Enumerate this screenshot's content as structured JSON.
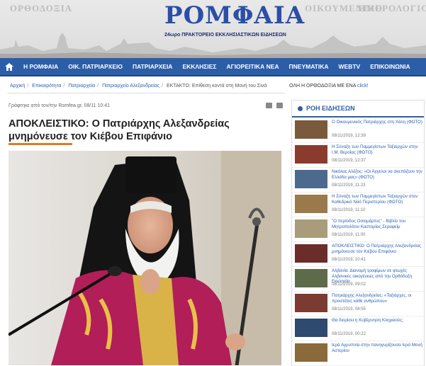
{
  "header": {
    "logo": "ΡΟΜΦΑΙΑ",
    "tagline": "24ωρο ΠΡΑΚΤΟΡΕΙΟ ΕΚΚΛΗΣΙΑΣΤΙΚΩΝ ΕΙΔΗΣΕΩΝ",
    "sky_left": "ΟΡΘΟΔΟΞΙΑ",
    "sky_right": "ΟΙΚΟΥΜΕΝΙΚΟ",
    "sky_right2": "ΗΜΕΡΟΛΟΓΙΟ"
  },
  "nav": {
    "items": [
      {
        "label": "Η ΡΟΜΦΑΙΑ"
      },
      {
        "label": "ΟΙΚ. ΠΑΤΡΙΑΡΧΕΙΟ"
      },
      {
        "label": "ΠΑΤΡΙΑΡΧΕΙΑ"
      },
      {
        "label": "ΕΚΚΛΗΣΙΕΣ"
      },
      {
        "label": "ΑΓΙΟΡΕΙΤΙΚΑ ΝΕΑ"
      },
      {
        "label": "ΠΝΕΥΜΑΤΙΚΑ"
      },
      {
        "label": "WEBTV"
      },
      {
        "label": "ΕΠΙΚΟΙΝΩΝΙΑ"
      }
    ]
  },
  "breadcrumb": {
    "items": [
      "Αρχική",
      "Επικαιρότητα",
      "Πατριαρχεία",
      "Πατριαρχείο Αλεξανδρείας"
    ],
    "current": "ΕΚΤΑΚΤΟ: Επίθεση κοντά στη Μονή του Σινά"
  },
  "ortho": {
    "text": "ΟΛΗ Η ΟΡΘΟΔΟΞΙΑ ΜΕ ΕΝΑ",
    "link": "click!"
  },
  "article": {
    "byline": "Γράφτηκε από τον/την Romfea.gr, 08/11 10:41",
    "title": "ΑΠΟΚΛΕΙΣΤΙΚΟ: Ο Πατριάρχης Αλεξανδρείας μνημόνευσε τον Κιέβου Επιφάνιο"
  },
  "sidebar": {
    "heading": "ΡΟΗ ΕΙΔΗΣΕΩΝ",
    "items": [
      {
        "title": "Ο Οικουμενικός Πατριάρχης στη Χάλη (ΦΩΤΟ)",
        "date": "08/11/2019, 12:39",
        "thumb": "#7a5a3c"
      },
      {
        "title": "Η Σύναξη των Παμμεγίστων Ταξιαρχών στην Ι.Μ. Βεροίας (ΦΩΤΟ)",
        "date": "08/11/2019, 12:37",
        "thumb": "#8b3a2e"
      },
      {
        "title": "Νικόλας Αλέξος: «Οι Άγγελοι να σκεπάζουν την Ελλάδα μας» (ΦΩΤΟ)",
        "date": "08/11/2019, 11:23",
        "thumb": "#4b6a8d"
      },
      {
        "title": "Η Σύναξη των Παμμεγίστων Ταξιαρχών στον Καθεδρικό Ναό Περιστερίου (ΦΩΤΟ)",
        "date": "08/11/2019, 11:10",
        "thumb": "#9a7a4a"
      },
      {
        "title": "\"Ο περίοδος Οσιομάρτυς\" - Βιβλίο του Μητροπολίτου Καστορίας Σεραφείμ",
        "date": "08/11/2019, 11:00",
        "thumb": "#a99c7a"
      },
      {
        "title": "ΑΠΟΚΛΕΙΣΤΙΚΟ: Ο Πατριάρχης Αλεξανδρείας μνημόνευσε τον Κιέβου Επιφάνιο",
        "date": "08/11/2019, 10:41",
        "thumb": "#6b2d2a"
      },
      {
        "title": "Αλβανία: Διανομή τροφίμων σε φτωχές Αλβανικές οικογένειες από την Ορθόδοξη Εκκλησία",
        "date": "08/11/2019, 09:02",
        "thumb": "#5d6b4a"
      },
      {
        "title": "Πατριάρχης Αλεξανδρείας: «Ταξιάρχες, οι προστάτες κάθε ανθρώπου»",
        "date": "08/11/2019, 08:55",
        "thumb": "#7b3b30"
      },
      {
        "title": "Θα διορίσει η Κυβέρνηση Κληρικούς;",
        "date": "08/11/2019, 00:22",
        "thumb": "#2e4a6e"
      },
      {
        "title": "Ιερά Αγρυπνία στην πανηγυρίζουσα Ιερά Μονή Αστερίου",
        "date": "",
        "thumb": "#8a6a3a"
      }
    ]
  },
  "colors": {
    "brand": "#2c5ea8",
    "accent": "#e07c1f"
  }
}
